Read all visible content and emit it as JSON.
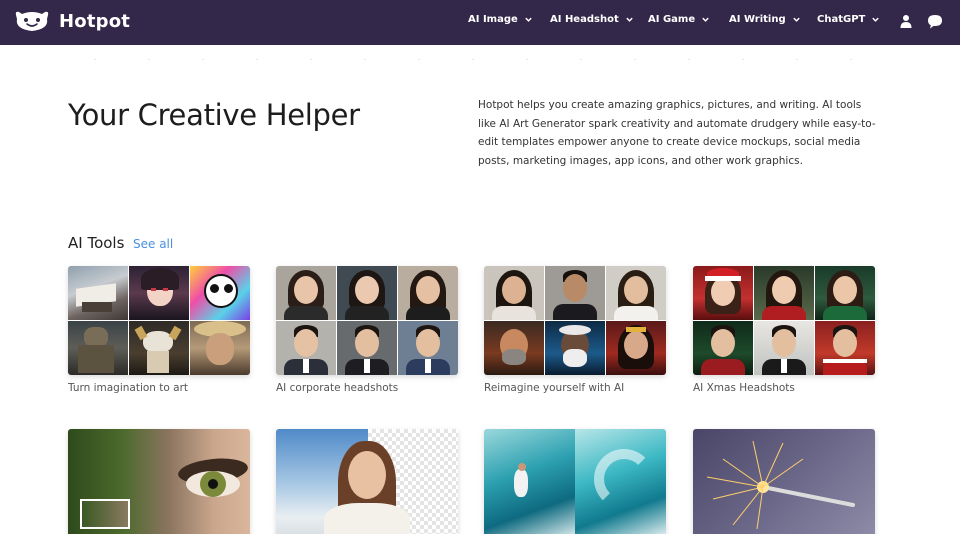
{
  "header": {
    "brand": "Hotpot",
    "nav": [
      {
        "label": "AI Image"
      },
      {
        "label": "AI Headshot"
      },
      {
        "label": "AI Game"
      },
      {
        "label": "AI Writing"
      },
      {
        "label": "ChatGPT"
      }
    ],
    "icons": [
      "user-icon",
      "chat-icon"
    ]
  },
  "hero": {
    "title": "Your Creative Helper",
    "description": "Hotpot helps you create amazing graphics, pictures, and writing. AI tools like AI Art Generator spark creativity and automate drudgery while easy-to-edit templates empower anyone to create device mockups, social media posts, marketing images, app icons, and other work graphics."
  },
  "tools": {
    "title": "AI Tools",
    "see_all": "See all",
    "cards": [
      {
        "label": "Turn imagination to art"
      },
      {
        "label": "AI corporate headshots"
      },
      {
        "label": "Reimagine yourself with AI"
      },
      {
        "label": "AI Xmas Headshots"
      },
      {
        "label": ""
      },
      {
        "label": ""
      },
      {
        "label": ""
      },
      {
        "label": ""
      }
    ]
  },
  "colors": {
    "navbar": "#33284a",
    "link": "#4a90e2"
  }
}
